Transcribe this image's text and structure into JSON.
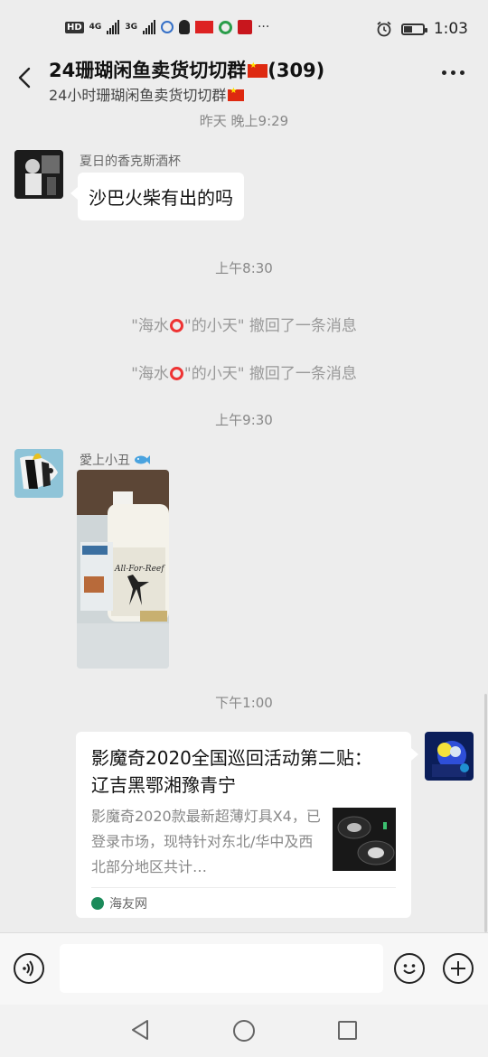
{
  "status_bar": {
    "network_badges": [
      "HD",
      "4G",
      "3G"
    ],
    "time": "1:03",
    "battery_level": 0.4
  },
  "header": {
    "title": "24珊瑚闲鱼卖货切切群",
    "member_count": "(309)",
    "subtitle": "24小时珊瑚闲鱼卖货切切群"
  },
  "chat": {
    "time_sep_1": "昨天 晚上9:29",
    "msg1": {
      "sender": "夏日的香克斯酒杯",
      "text": "沙巴火柴有出的吗"
    },
    "time_sep_2": "上午8:30",
    "recall_1": {
      "prefix": "\"海水",
      "suffix": "\"的小天\" 撤回了一条消息"
    },
    "recall_2": {
      "prefix": "\"海水",
      "suffix": "\"的小天\" 撤回了一条消息"
    },
    "time_sep_3": "上午9:30",
    "msg2": {
      "sender": "愛上小丑",
      "bottle_label": "All-For-Reef"
    },
    "time_sep_4": "下午1:00",
    "card": {
      "title": "影魔奇2020全国巡回活动第二贴： 辽吉黑鄂湘豫青宁",
      "desc": "影魔奇2020款最新超薄灯具X4，已登录市场，现特针对东北/华中及西北部分地区共计…",
      "source": "海友网"
    }
  },
  "input_bar": {
    "placeholder": ""
  }
}
